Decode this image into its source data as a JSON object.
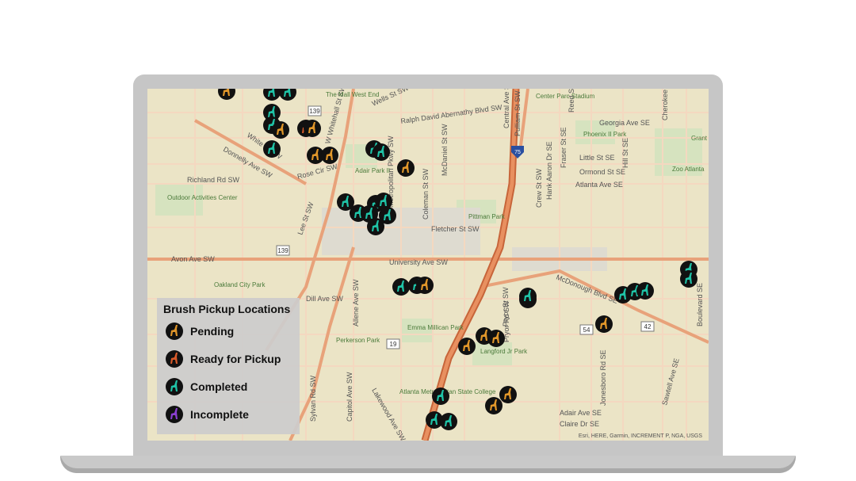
{
  "legend": {
    "title": "Brush Pickup Locations",
    "items": [
      {
        "label": "Pending",
        "color": "#e0962a"
      },
      {
        "label": "Ready for Pickup",
        "color": "#d85a2a"
      },
      {
        "label": "Completed",
        "color": "#1fc2a6"
      },
      {
        "label": "Incomplete",
        "color": "#8a3fd0"
      }
    ]
  },
  "attribution": "Esri, HERE, Garmin, INCREMENT P, NGA, USGS",
  "street_labels": [
    "Ralph David Abernathy Blvd SW",
    "Wells St SW",
    "W Whitehall St SW",
    "Donnelly Ave SW",
    "White St SW",
    "Rose Cir SW",
    "Richland Rd SW",
    "Lee St SW",
    "Avon Ave SW",
    "Dill Ave SW",
    "Allene Ave SW",
    "Sylvan Rd SW",
    "Fletcher St SW",
    "University Ave SW",
    "McDaniel St SW",
    "Coleman St SW",
    "Pryor St SW",
    "Georgia Ave SE",
    "Ormond St SE",
    "Little St SE",
    "Atlanta Ave SE",
    "McDonough Blvd SE",
    "Crew St SW",
    "Hank Aaron Dr SE",
    "Boulevard SE",
    "Jonesboro Rd SE",
    "Adair Ave SE",
    "Claire Dr SE",
    "Capitol Ave SW",
    "Metropolitan Pkwy SW",
    "Pulliam St SW",
    "Central Ave SW",
    "Sawtell Ave SE",
    "Hill St SE",
    "Fraser St SE",
    "Reed St SE",
    "Pryor Rd SW",
    "Cherokee Ave SE",
    "Grant Park",
    "Zoo Atlanta",
    "Pittman Park",
    "Adair Park II",
    "Oakland City Park",
    "Outdoor Activities Center",
    "Emma Millican Park",
    "Perkerson Park",
    "Phoenix II Park",
    "Langford Jr Park",
    "Atlanta Metropolitan State College",
    "Center Parc Stadium",
    "The Mall West End",
    "Lakewood Ave SW"
  ],
  "route_shields": [
    "139",
    "139",
    "75",
    "19",
    "42",
    "54"
  ],
  "markers": [
    {
      "status": "Pending"
    },
    {
      "status": "Completed"
    },
    {
      "status": "Completed"
    },
    {
      "status": "Completed"
    },
    {
      "status": "Completed"
    },
    {
      "status": "Ready for Pickup"
    },
    {
      "status": "Pending"
    },
    {
      "status": "Pending"
    },
    {
      "status": "Pending"
    },
    {
      "status": "Pending"
    },
    {
      "status": "Completed"
    },
    {
      "status": "Pending"
    },
    {
      "status": "Completed"
    },
    {
      "status": "Completed"
    },
    {
      "status": "Completed"
    },
    {
      "status": "Completed"
    },
    {
      "status": "Completed"
    },
    {
      "status": "Completed"
    },
    {
      "status": "Completed"
    },
    {
      "status": "Completed"
    },
    {
      "status": "Completed"
    },
    {
      "status": "Completed"
    },
    {
      "status": "Completed"
    },
    {
      "status": "Pending"
    },
    {
      "status": "Pending"
    },
    {
      "status": "Pending"
    },
    {
      "status": "Pending"
    },
    {
      "status": "Pending"
    },
    {
      "status": "Pending"
    },
    {
      "status": "Completed"
    },
    {
      "status": "Completed"
    },
    {
      "status": "Completed"
    },
    {
      "status": "Completed"
    },
    {
      "status": "Pending"
    },
    {
      "status": "Pending"
    },
    {
      "status": "Completed"
    },
    {
      "status": "Completed"
    },
    {
      "status": "Completed"
    },
    {
      "status": "Completed"
    },
    {
      "status": "Completed"
    }
  ]
}
